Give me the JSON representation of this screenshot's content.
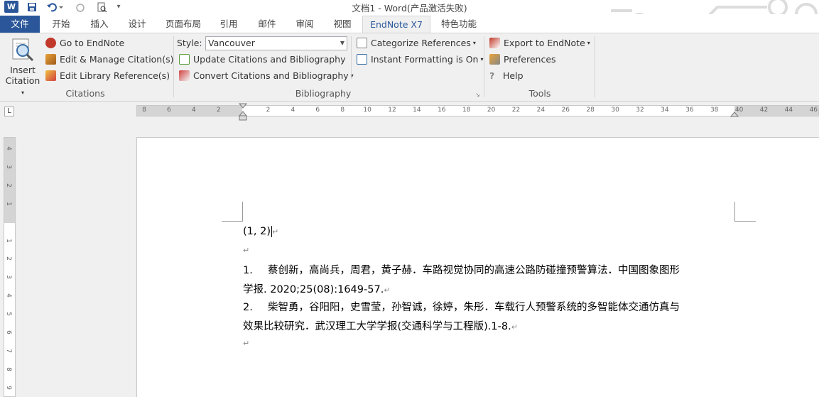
{
  "window": {
    "title": "文档1 - Word(产品激活失败)"
  },
  "tabs": [
    {
      "label": "文件"
    },
    {
      "label": "开始"
    },
    {
      "label": "插入"
    },
    {
      "label": "设计"
    },
    {
      "label": "页面布局"
    },
    {
      "label": "引用"
    },
    {
      "label": "邮件"
    },
    {
      "label": "审阅"
    },
    {
      "label": "视图"
    },
    {
      "label": "EndNote X7"
    },
    {
      "label": "特色功能"
    }
  ],
  "ribbon": {
    "insert_citation": {
      "line1": "Insert",
      "line2": "Citation"
    },
    "citations": {
      "goto": "Go to EndNote",
      "edit_manage": "Edit & Manage Citation(s)",
      "edit_library": "Edit Library Reference(s)",
      "label": "Citations"
    },
    "bibliography": {
      "style_label": "Style:",
      "style_value": "Vancouver",
      "update": "Update Citations and Bibliography",
      "convert": "Convert Citations and Bibliography",
      "categorize": "Categorize References",
      "instant": "Instant Formatting is On",
      "label": "Bibliography"
    },
    "tools": {
      "export": "Export to EndNote",
      "preferences": "Preferences",
      "help": "Help",
      "label": "Tools"
    }
  },
  "ruler": {
    "labels": [
      "8",
      "6",
      "4",
      "2",
      "",
      "2",
      "4",
      "6",
      "8",
      "10",
      "12",
      "14",
      "16",
      "18",
      "20",
      "22",
      "24",
      "26",
      "28",
      "30",
      "32",
      "34",
      "36",
      "38",
      "40",
      "42",
      "44",
      "46"
    ]
  },
  "vruler": {
    "labels": [
      "4",
      "3",
      "2",
      "1",
      "",
      "1",
      "2",
      "3",
      "4",
      "5",
      "6",
      "7",
      "8",
      "9"
    ]
  },
  "document": {
    "citation": "(1, 2)",
    "refs": [
      {
        "num": "1.",
        "line1": "蔡创新，高尚兵，周君，黄子赫．车路视觉协同的高速公路防碰撞预警算法．中国图象图形",
        "line2": "学报. 2020;25(08):1649-57."
      },
      {
        "num": "2.",
        "line1": "柴智勇，谷阳阳，史雪莹，孙智诚，徐婷，朱彤．车载行人预警系统的多智能体交通仿真与",
        "line2": "效果比较研究．武汉理工大学学报(交通科学与工程版).1-8."
      }
    ],
    "para_mark": "↵"
  },
  "colors": {
    "accent": "#2b579a"
  }
}
